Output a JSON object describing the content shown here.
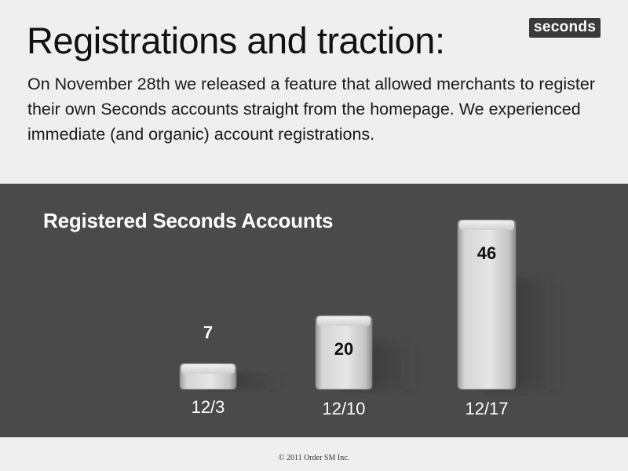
{
  "slide": {
    "title": "Registrations and traction:",
    "intro": "On November 28th we released a feature that allowed merchants to register their own Seconds accounts straight from the homepage.  We experienced immediate (and organic) account registrations.",
    "footer": "© 2011 Order SM Inc."
  },
  "logo": {
    "text": "seconds"
  },
  "chart_data": {
    "type": "bar",
    "title": "Registered Seconds Accounts",
    "categories": [
      "12/3",
      "12/10",
      "12/17"
    ],
    "values": [
      7,
      20,
      46
    ],
    "xlabel": "",
    "ylabel": "",
    "grid": false,
    "legend": "none",
    "colors": {
      "panel": "#4a4a4a",
      "bar": "#d0d0d0",
      "label_on_dark": "#ffffff",
      "label_on_bar": "#111111"
    }
  }
}
